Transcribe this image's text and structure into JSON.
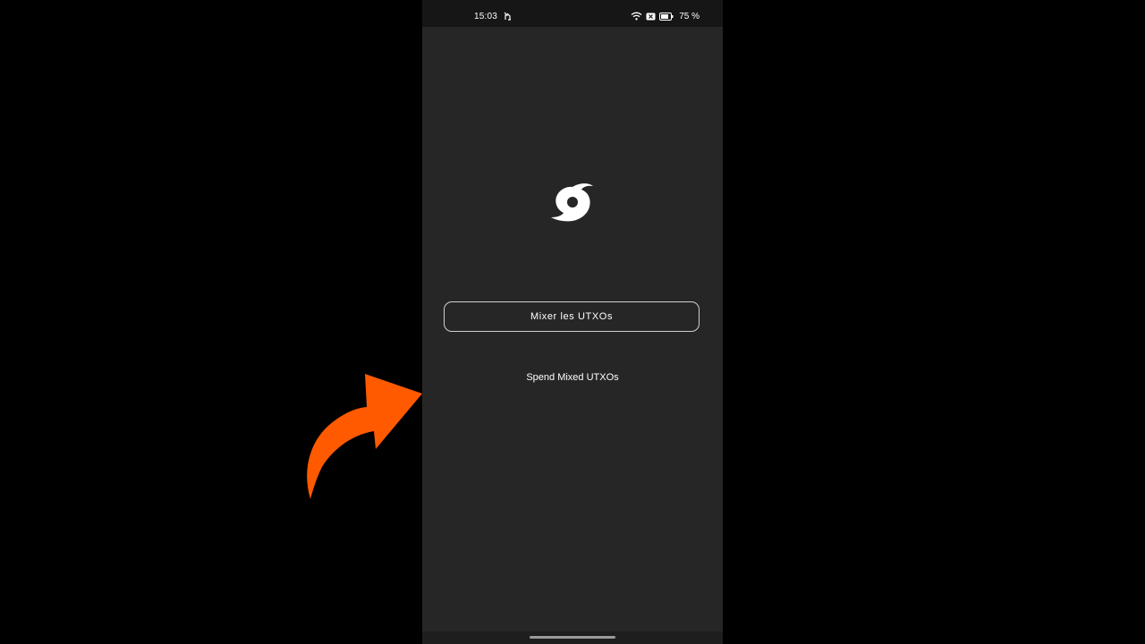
{
  "status_bar": {
    "time": "15:03",
    "battery": "75 %"
  },
  "app": {
    "logo_icon": "whirlpool-logo-icon",
    "mix_button_label": "Mixer les UTXOs",
    "spend_link_label": "Spend Mixed UTXOs"
  },
  "annotation": {
    "arrow_icon": "curved-arrow-icon",
    "arrow_color": "#ff5a00"
  },
  "colors": {
    "phone_background": "#262626",
    "outer_background": "#000000",
    "text": "#ffffff"
  }
}
